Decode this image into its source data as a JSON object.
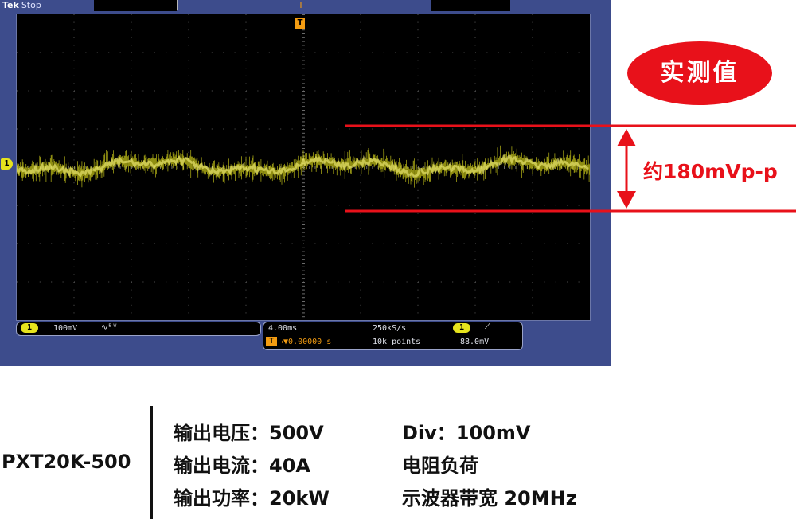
{
  "scope": {
    "brand": "Tek",
    "run_state": "Stop",
    "channel_marker": "1",
    "trigger_marker": "T",
    "trigger_top_marker": "T",
    "readout": {
      "ch_chip": "1",
      "ch_scale": "100mV",
      "ch_bw_icon": "∿ᴮᵂ",
      "time_scale": "4.00ms",
      "sample_rate": "250kS/s",
      "trig_chip": "1",
      "trig_slope_icon": "⟋",
      "trig_mode_icon": "T",
      "trig_delay": "→▼0.00000 s",
      "record_length": "10k points",
      "trig_level": "88.0mV"
    },
    "colors": {
      "trace": "#e6e31d",
      "frame": "#3d4c8c",
      "annotation": "#e8111a"
    }
  },
  "annotation": {
    "badge": "实测值",
    "vpp": "约180mVp-p"
  },
  "specs": {
    "model": "PXT20K-500",
    "left": [
      "输出电压：500V",
      "输出电流：40A",
      "输出功率：20kW"
    ],
    "right": [
      "Div：100mV",
      "电阻负荷",
      "示波器带宽 20MHz"
    ]
  }
}
